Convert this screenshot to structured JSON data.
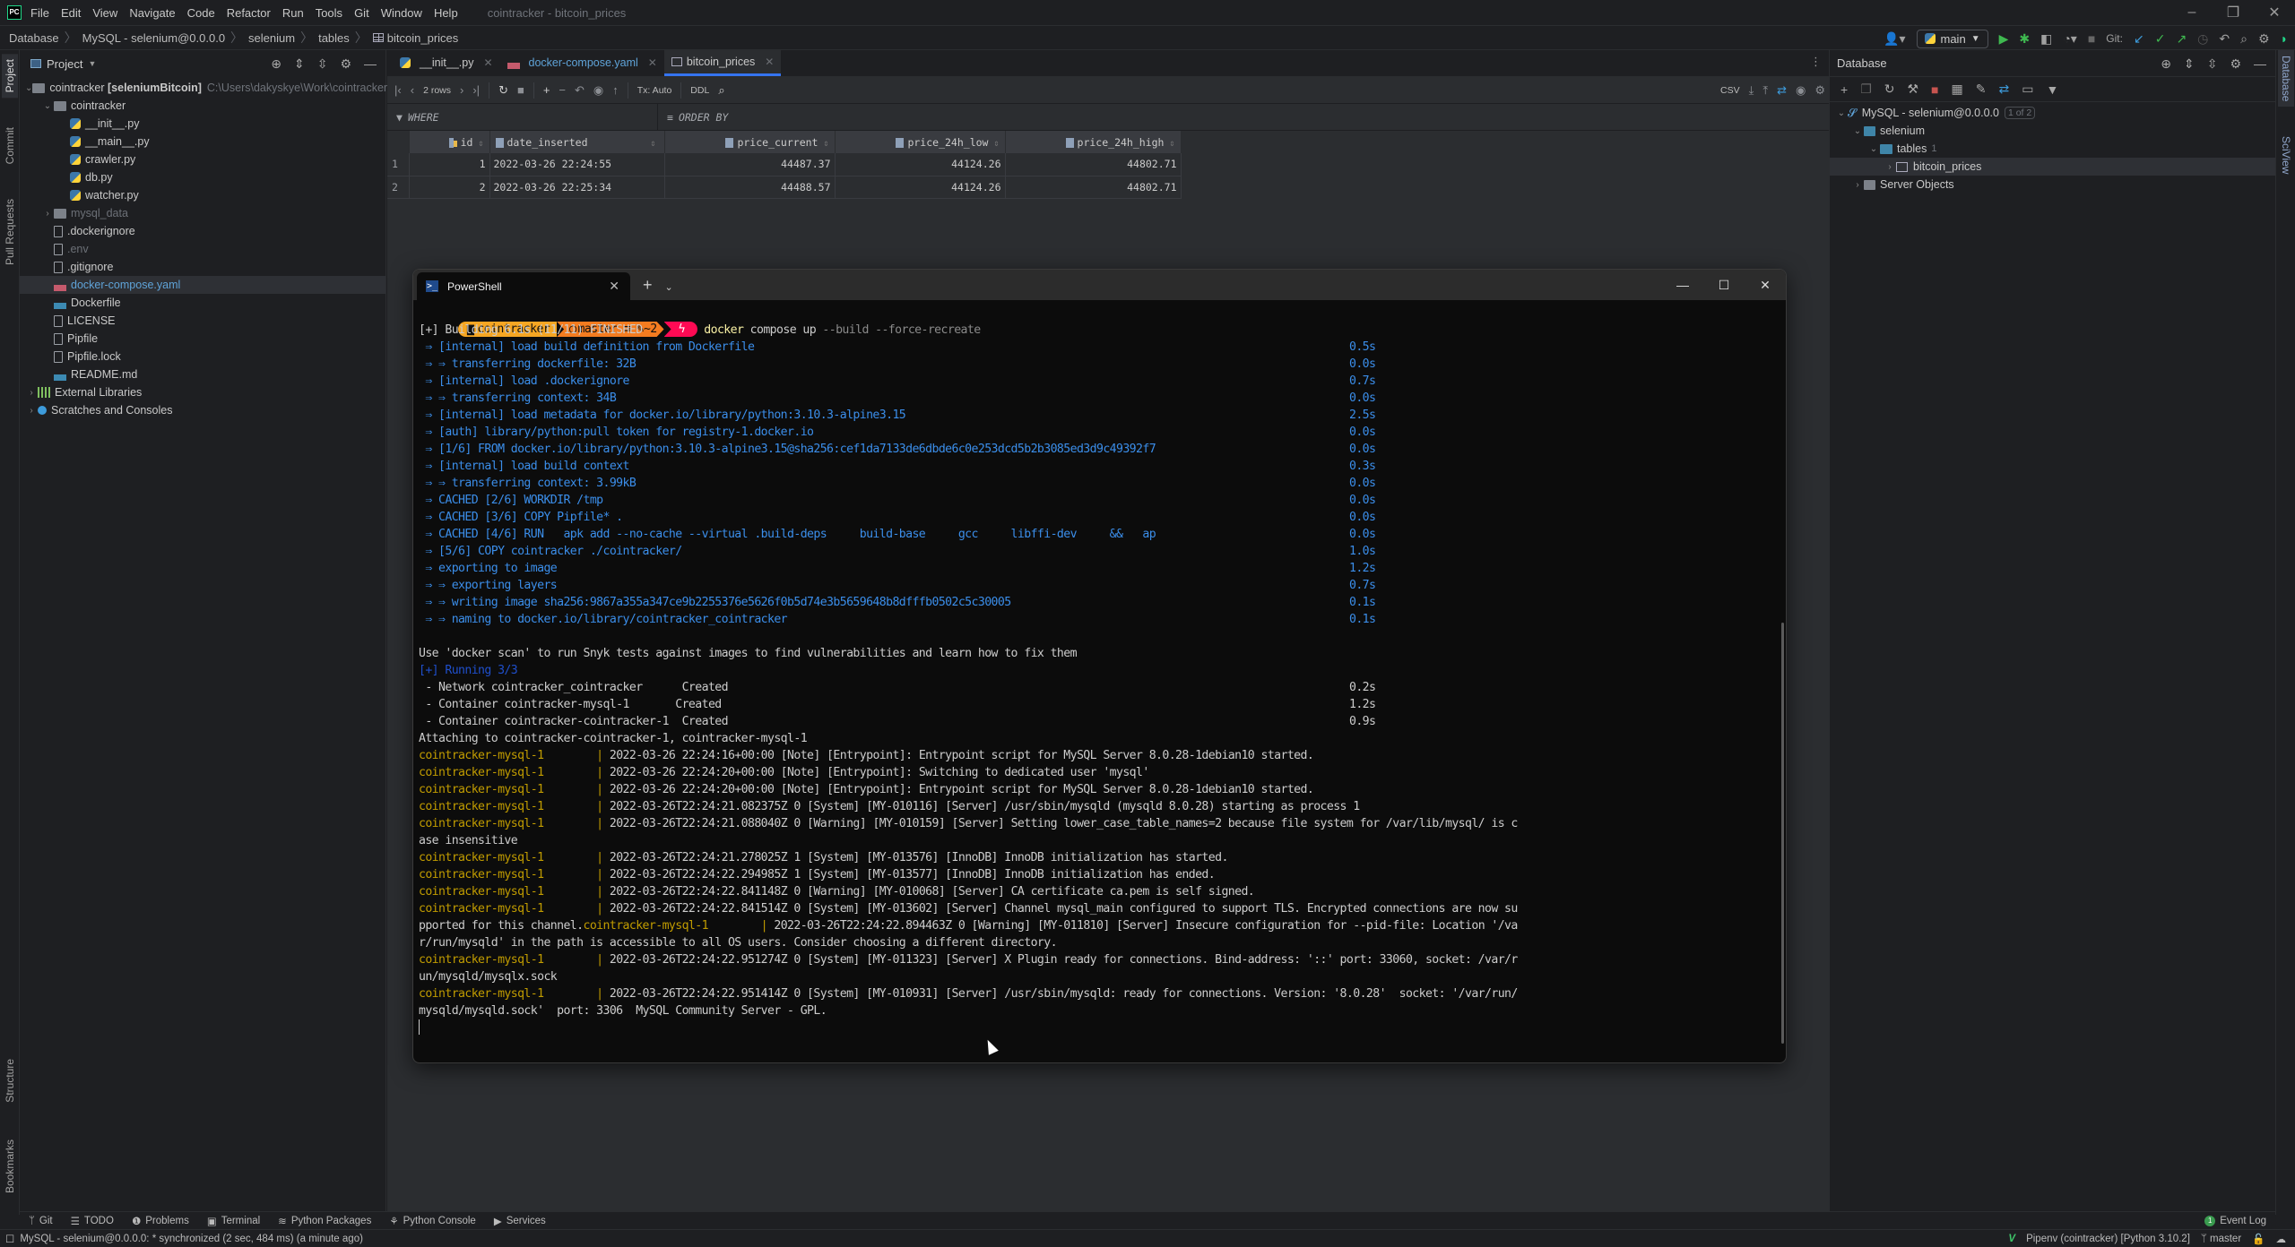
{
  "app": {
    "menu": [
      "File",
      "Edit",
      "View",
      "Navigate",
      "Code",
      "Refactor",
      "Run",
      "Tools",
      "Git",
      "Window",
      "Help"
    ],
    "window_title": "cointracker - bitcoin_prices",
    "logo": "PC"
  },
  "breadcrumb": [
    "Database",
    "MySQL - selenium@0.0.0.0",
    "selenium",
    "tables",
    "bitcoin_prices"
  ],
  "toolbar": {
    "run_config": "main",
    "git_label": "Git:"
  },
  "left_stripe": [
    "Project",
    "Commit",
    "Pull Requests",
    "Structure",
    "Bookmarks"
  ],
  "right_stripe": [
    "Database",
    "SciView"
  ],
  "project": {
    "title": "Project",
    "root": {
      "name": "cointracker",
      "module": "[seleniumBitcoin]",
      "path": "C:\\Users\\dakyskye\\Work\\cointracker"
    },
    "items": [
      {
        "name": "cointracker",
        "type": "folder",
        "level": 1,
        "expanded": true
      },
      {
        "name": "__init__.py",
        "type": "py",
        "level": 2
      },
      {
        "name": "__main__.py",
        "type": "py",
        "level": 2
      },
      {
        "name": "crawler.py",
        "type": "py",
        "level": 2
      },
      {
        "name": "db.py",
        "type": "py",
        "level": 2
      },
      {
        "name": "watcher.py",
        "type": "py",
        "level": 2
      },
      {
        "name": "mysql_data",
        "type": "folder",
        "level": 1,
        "muted": true
      },
      {
        "name": ".dockerignore",
        "type": "file",
        "level": 1
      },
      {
        "name": ".env",
        "type": "file",
        "level": 1,
        "muted": true
      },
      {
        "name": ".gitignore",
        "type": "file",
        "level": 1
      },
      {
        "name": "docker-compose.yaml",
        "type": "yml",
        "level": 1,
        "selected": true
      },
      {
        "name": "Dockerfile",
        "type": "docker",
        "level": 1
      },
      {
        "name": "LICENSE",
        "type": "file",
        "level": 1
      },
      {
        "name": "Pipfile",
        "type": "file",
        "level": 1
      },
      {
        "name": "Pipfile.lock",
        "type": "file",
        "level": 1
      },
      {
        "name": "README.md",
        "type": "md",
        "level": 1
      }
    ],
    "extra": [
      "External Libraries",
      "Scratches and Consoles"
    ]
  },
  "editor": {
    "tabs": [
      {
        "label": "__init__.py",
        "active": false
      },
      {
        "label": "docker-compose.yaml",
        "active": false
      },
      {
        "label": "bitcoin_prices",
        "active": true
      }
    ],
    "grid_toolbar": {
      "rows": "2 rows",
      "tx": "Tx: Auto",
      "ddl": "DDL",
      "export": "CSV"
    },
    "filter": {
      "where": "WHERE",
      "order_by": "ORDER BY"
    },
    "columns": [
      "id",
      "date_inserted",
      "price_current",
      "price_24h_low",
      "price_24h_high"
    ],
    "rows": [
      {
        "n": "1",
        "id": "1",
        "date_inserted": "2022-03-26 22:24:55",
        "price_current": "44487.37",
        "price_24h_low": "44124.26",
        "price_24h_high": "44802.71"
      },
      {
        "n": "2",
        "id": "2",
        "date_inserted": "2022-03-26 22:25:34",
        "price_current": "44488.57",
        "price_24h_low": "44124.26",
        "price_24h_high": "44802.71"
      }
    ]
  },
  "database": {
    "title": "Database",
    "connection": "MySQL - selenium@0.0.0.0",
    "connection_badge": "1 of 2",
    "schema": "selenium",
    "tables_label": "tables",
    "tables_count": "1",
    "table": "bitcoin_prices",
    "server_objects": "Server Objects"
  },
  "powershell": {
    "tab_title": "PowerShell",
    "prompt": {
      "dir": "cointracker",
      "branch": "master",
      "git_status": "≡ ✎~2",
      "cmd": "docker",
      "args": " compose up",
      "opts": " --build --force-recreate"
    },
    "build_header": "[+] Building 6.1s (11/11) FINISHED",
    "build_steps": [
      {
        "text": " ⇒ [internal] load build definition from Dockerfile",
        "time": "0.5s"
      },
      {
        "text": " ⇒ ⇒ transferring dockerfile: 32B",
        "time": "0.0s"
      },
      {
        "text": " ⇒ [internal] load .dockerignore",
        "time": "0.7s"
      },
      {
        "text": " ⇒ ⇒ transferring context: 34B",
        "time": "0.0s"
      },
      {
        "text": " ⇒ [internal] load metadata for docker.io/library/python:3.10.3-alpine3.15",
        "time": "2.5s"
      },
      {
        "text": " ⇒ [auth] library/python:pull token for registry-1.docker.io",
        "time": "0.0s"
      },
      {
        "text": " ⇒ [1/6] FROM docker.io/library/python:3.10.3-alpine3.15@sha256:cef1da7133de6dbde6c0e253dcd5b2b3085ed3d9c49392f7",
        "time": "0.0s"
      },
      {
        "text": " ⇒ [internal] load build context",
        "time": "0.3s"
      },
      {
        "text": " ⇒ ⇒ transferring context: 3.99kB",
        "time": "0.0s"
      },
      {
        "text": " ⇒ CACHED [2/6] WORKDIR /tmp",
        "time": "0.0s"
      },
      {
        "text": " ⇒ CACHED [3/6] COPY Pipfile* .",
        "time": "0.0s"
      },
      {
        "text": " ⇒ CACHED [4/6] RUN   apk add --no-cache --virtual .build-deps     build-base     gcc     libffi-dev     &&   ap",
        "time": "0.0s"
      },
      {
        "text": " ⇒ [5/6] COPY cointracker ./cointracker/",
        "time": "1.0s"
      },
      {
        "text": " ⇒ exporting to image",
        "time": "1.2s"
      },
      {
        "text": " ⇒ ⇒ exporting layers",
        "time": "0.7s"
      },
      {
        "text": " ⇒ ⇒ writing image sha256:9867a355a347ce9b2255376e5626f0b5d74e3b5659648b8dfffb0502c5c30005",
        "time": "0.1s"
      },
      {
        "text": " ⇒ ⇒ naming to docker.io/library/cointracker_cointracker",
        "time": "0.1s"
      }
    ],
    "scan_hint": "Use 'docker scan' to run Snyk tests against images to find vulnerabilities and learn how to fix them",
    "running_header": "[+] Running 3/3",
    "running": [
      {
        "text": " - Network cointracker_cointracker      Created",
        "time": "0.2s"
      },
      {
        "text": " - Container cointracker-mysql-1       Created",
        "time": "1.2s"
      },
      {
        "text": " - Container cointracker-cointracker-1  Created",
        "time": "0.9s"
      }
    ],
    "attaching": "Attaching to cointracker-cointracker-1, cointracker-mysql-1",
    "log_prefix": "cointracker-mysql-1        | ",
    "logs": [
      {
        "p": true,
        "text": "2022-03-26 22:24:16+00:00 [Note] [Entrypoint]: Entrypoint script for MySQL Server 8.0.28-1debian10 started."
      },
      {
        "p": true,
        "text": "2022-03-26 22:24:20+00:00 [Note] [Entrypoint]: Switching to dedicated user 'mysql'"
      },
      {
        "p": true,
        "text": "2022-03-26 22:24:20+00:00 [Note] [Entrypoint]: Entrypoint script for MySQL Server 8.0.28-1debian10 started."
      },
      {
        "p": true,
        "text": "2022-03-26T22:24:21.082375Z 0 [System] [MY-010116] [Server] /usr/sbin/mysqld (mysqld 8.0.28) starting as process 1"
      },
      {
        "p": true,
        "text": "2022-03-26T22:24:21.088040Z 0 [Warning] [MY-010159] [Server] Setting lower_case_table_names=2 because file system for /var/lib/mysql/ is c"
      },
      {
        "p": false,
        "text": "ase insensitive"
      },
      {
        "p": true,
        "text": "2022-03-26T22:24:21.278025Z 1 [System] [MY-013576] [InnoDB] InnoDB initialization has started."
      },
      {
        "p": true,
        "text": "2022-03-26T22:24:22.294985Z 1 [System] [MY-013577] [InnoDB] InnoDB initialization has ended."
      },
      {
        "p": true,
        "text": "2022-03-26T22:24:22.841148Z 0 [Warning] [MY-010068] [Server] CA certificate ca.pem is self signed."
      },
      {
        "p": true,
        "text": "2022-03-26T22:24:22.841514Z 0 [System] [MY-013602] [Server] Channel mysql_main configured to support TLS. Encrypted connections are now su"
      },
      {
        "p": false,
        "mid": true,
        "text": "pported for this channel.",
        "text2": "2022-03-26T22:24:22.894463Z 0 [Warning] [MY-011810] [Server] Insecure configuration for --pid-file: Location '/va"
      },
      {
        "p": false,
        "text": "r/run/mysqld' in the path is accessible to all OS users. Consider choosing a different directory."
      },
      {
        "p": true,
        "text": "2022-03-26T22:24:22.951274Z 0 [System] [MY-011323] [Server] X Plugin ready for connections. Bind-address: '::' port: 33060, socket: /var/r"
      },
      {
        "p": false,
        "text": "un/mysqld/mysqlx.sock"
      },
      {
        "p": true,
        "text": "2022-03-26T22:24:22.951414Z 0 [System] [MY-010931] [Server] /usr/sbin/mysqld: ready for connections. Version: '8.0.28'  socket: '/var/run/"
      },
      {
        "p": false,
        "text": "mysqld/mysqld.sock'  port: 3306  MySQL Community Server - GPL."
      }
    ]
  },
  "tool_windows": [
    "Git",
    "TODO",
    "Problems",
    "Terminal",
    "Python Packages",
    "Python Console",
    "Services"
  ],
  "event_log": {
    "label": "Event Log",
    "count": "1"
  },
  "status": {
    "message": "MySQL - selenium@0.0.0.0: * synchronized (2 sec, 484 ms) (a minute ago)",
    "interpreter": "Pipenv (cointracker) [Python 3.10.2]",
    "branch": "master"
  }
}
